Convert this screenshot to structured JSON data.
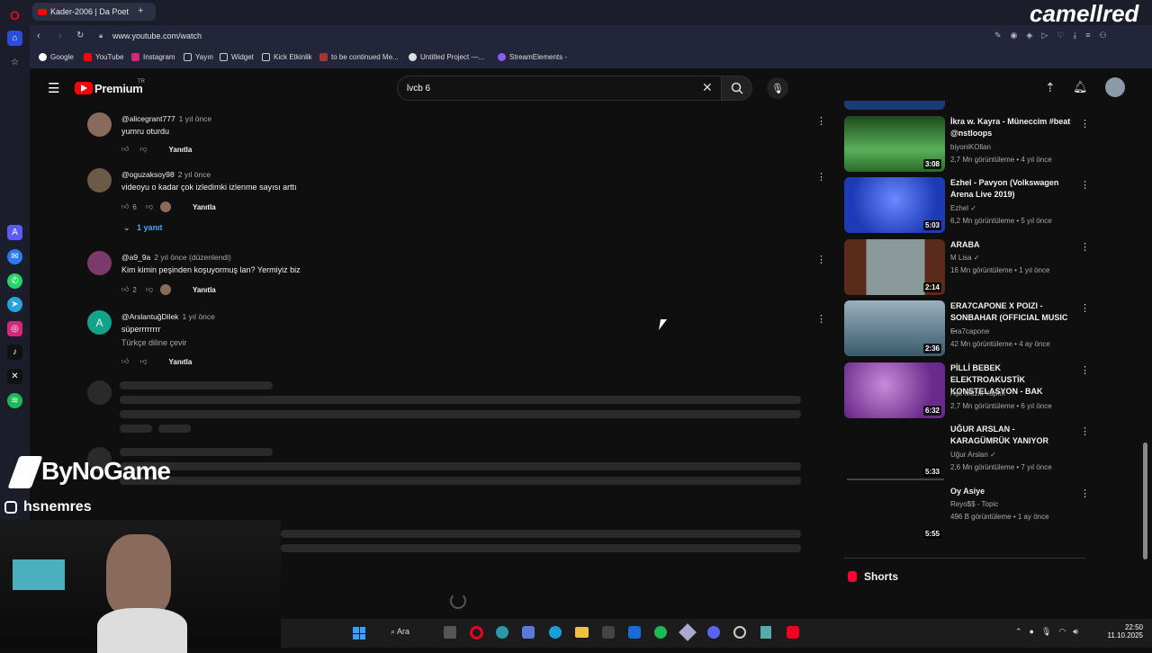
{
  "browser": {
    "tab_title": "Kader-2006 | Da Poet",
    "url": "www.youtube.com/watch",
    "bookmarks": [
      "Google",
      "YouTube",
      "Instagram",
      "Yayın",
      "Widget",
      "Kick Etkinlik",
      "to be continued Me...",
      "Untitled Project —...",
      "StreamElements -"
    ]
  },
  "youtube": {
    "logo_text": "Premium",
    "logo_sup": "TR",
    "search_value": "lvcb 6"
  },
  "comments": [
    {
      "handle": "@alicegrant777",
      "age": "1 yıl önce",
      "text": "yumru oturdu",
      "likes": "",
      "reply": "Yanıtla",
      "avatar_color": "#8a6a5a"
    },
    {
      "handle": "@oguzaksoy98",
      "age": "2 yıl önce",
      "text": "videoyu o kadar çok izledimki izlenme sayısı arttı",
      "likes": "6",
      "reply": "Yanıtla",
      "replies_label": "1 yanıt",
      "avatar_color": "#6b5a48"
    },
    {
      "handle": "@a9_9a",
      "age": "2 yıl önce (düzenlendi)",
      "text": "Kim kimin peşinden koşuyormuş lan? Yermiyiz biz",
      "likes": "2",
      "reply": "Yanıtla",
      "avatar_color": "#7a3a6a"
    },
    {
      "handle": "@ArslantuğDilek",
      "age": "1 yıl önce",
      "text": "süperrrrrrrr",
      "text2": "Türkçe diline çevir",
      "likes": "",
      "reply": "Yanıtla",
      "avatar_letter": "A",
      "avatar_color": "#12a38a"
    }
  ],
  "related": [
    {
      "title": "İkra w. Kayra - Müneccim #beat @nstloops",
      "channel": "biyoniKOllan",
      "views": "2,7 Mn görüntüleme",
      "age": "4 yıl önce",
      "duration": "3:08",
      "thumb_color": "#3a7a3a"
    },
    {
      "title": "Ezhel - Pavyon (Volkswagen Arena Live 2019)",
      "channel": "Ezhel",
      "views": "6,2 Mn görüntüleme",
      "age": "5 yıl önce",
      "duration": "5:03",
      "thumb_color": "#1d3bb5"
    },
    {
      "title": "ARABA",
      "channel": "M Lisa",
      "views": "16 Mn görüntüleme",
      "age": "1 yıl önce",
      "duration": "2:14",
      "thumb_color": "#6a6a68"
    },
    {
      "title": "ERA7CAPONE X POIZI - SONBAHAR (OFFICIAL MUSIC ...",
      "channel": "Era7capone",
      "views": "42 Mn görüntüleme",
      "age": "4 ay önce",
      "duration": "2:36",
      "thumb_color": "#5a7a8a"
    },
    {
      "title": "PİLLİ BEBEK ELEKTROAKUSTİK KONSTELASYON - BAK",
      "channel": "Aşk Müzik Yapım",
      "views": "2,7 Mn görüntüleme",
      "age": "6 yıl önce",
      "duration": "6:32",
      "thumb_color": "#8a4a9a"
    },
    {
      "title": "UĞUR ARSLAN - KARAGÜMRÜK YANIYOR",
      "channel": "Uğur Arslan",
      "views": "2,6 Mn görüntüleme",
      "age": "7 yıl önce",
      "duration": "5:33",
      "thumb_color": "#0f0f0f"
    },
    {
      "title": "Oy Asiye",
      "channel": "Reyo$$ - Topic",
      "views": "496 B görüntüleme",
      "age": "1 ay önce",
      "duration": "5:55",
      "thumb_color": "#0f0f0f"
    }
  ],
  "shorts_label": "Shorts",
  "overlay": {
    "brand": "camellred",
    "sponsor": "ByNoGame",
    "instagram": "hsnemres"
  },
  "taskbar": {
    "search_label": "Ara",
    "time": "22:50",
    "date": "11.10.2025"
  },
  "colors": {
    "accent": "#ff0033",
    "link": "#3ea6ff"
  }
}
